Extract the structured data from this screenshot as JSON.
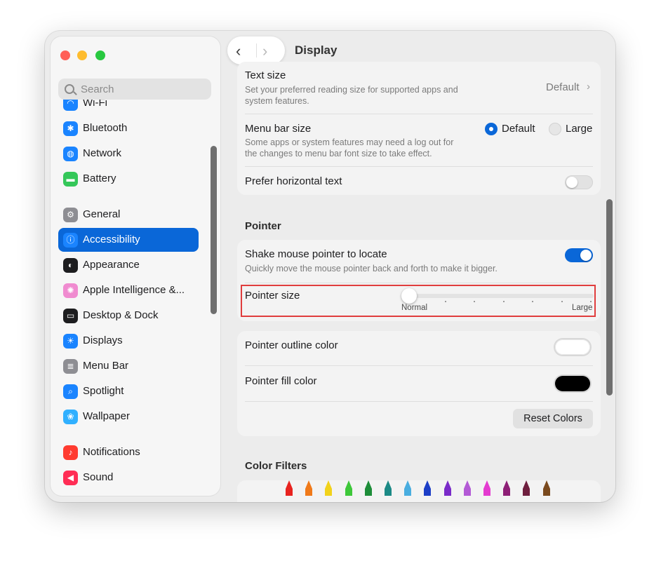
{
  "window": {
    "title": "Display"
  },
  "sidebar": {
    "search_placeholder": "Search",
    "items": [
      {
        "label": "Wi-Fi",
        "icon": "wifi-icon",
        "color": "#1a84ff",
        "glyph": "◠"
      },
      {
        "label": "Bluetooth",
        "icon": "bluetooth-icon",
        "color": "#1a84ff",
        "glyph": "✱"
      },
      {
        "label": "Network",
        "icon": "globe-icon",
        "color": "#1a84ff",
        "glyph": "◍"
      },
      {
        "label": "Battery",
        "icon": "battery-icon",
        "color": "#34c759",
        "glyph": "▬"
      },
      {
        "label": "General",
        "icon": "gear-icon",
        "color": "#8e8e93",
        "glyph": "⚙"
      },
      {
        "label": "Accessibility",
        "icon": "accessibility-icon",
        "color": "#1a84ff",
        "glyph": "ⓘ",
        "selected": true
      },
      {
        "label": "Appearance",
        "icon": "appearance-icon",
        "color": "#1d1d1f",
        "glyph": "◐"
      },
      {
        "label": "Apple Intelligence &...",
        "icon": "apple-intelligence-icon",
        "color": "#f08bd0",
        "glyph": "✺"
      },
      {
        "label": "Desktop & Dock",
        "icon": "dock-icon",
        "color": "#1d1d1f",
        "glyph": "▭"
      },
      {
        "label": "Displays",
        "icon": "sun-icon",
        "color": "#1a84ff",
        "glyph": "☀"
      },
      {
        "label": "Menu Bar",
        "icon": "menu-bar-icon",
        "color": "#8e8e93",
        "glyph": "≣"
      },
      {
        "label": "Spotlight",
        "icon": "spotlight-icon",
        "color": "#1a84ff",
        "glyph": "⌕"
      },
      {
        "label": "Wallpaper",
        "icon": "wallpaper-icon",
        "color": "#30b0ff",
        "glyph": "❀"
      },
      {
        "label": "Notifications",
        "icon": "bell-icon",
        "color": "#ff3b30",
        "glyph": "♪"
      },
      {
        "label": "Sound",
        "icon": "speaker-icon",
        "color": "#ff2d55",
        "glyph": "◀"
      }
    ]
  },
  "display": {
    "text_size": {
      "title": "Text size",
      "sub1": "Set your preferred reading size for supported apps and",
      "sub2": "system features.",
      "value": "Default"
    },
    "menu_bar_size": {
      "title": "Menu bar size",
      "sub1": "Some apps or system features may need a log out for",
      "sub2": "the changes to menu bar font size to take effect.",
      "option_default": "Default",
      "option_large": "Large"
    },
    "prefer_horizontal": {
      "title": "Prefer horizontal text",
      "enabled": false
    }
  },
  "pointer": {
    "heading": "Pointer",
    "shake": {
      "title": "Shake mouse pointer to locate",
      "sub": "Quickly move the mouse pointer back and forth to make it bigger.",
      "enabled": true
    },
    "size": {
      "title": "Pointer size",
      "min_label": "Normal",
      "max_label": "Large",
      "value_fraction": 0
    },
    "outline_color": {
      "title": "Pointer outline color",
      "color": "#ffffff"
    },
    "fill_color": {
      "title": "Pointer fill color",
      "color": "#000000"
    },
    "reset_button": "Reset Colors"
  },
  "color_filters": {
    "heading": "Color Filters",
    "pencil_colors": [
      "#e8231f",
      "#f07a1a",
      "#f2d21b",
      "#3ec83a",
      "#1e8e3a",
      "#1c8a86",
      "#4aaee0",
      "#1d3fc7",
      "#7a2bc9",
      "#b35ad6",
      "#e43bd0",
      "#8e1f76",
      "#6e1f3e",
      "#7a4a1e"
    ]
  },
  "colors": {
    "accent": "#0a67d8",
    "highlight": "#e03d3d"
  }
}
